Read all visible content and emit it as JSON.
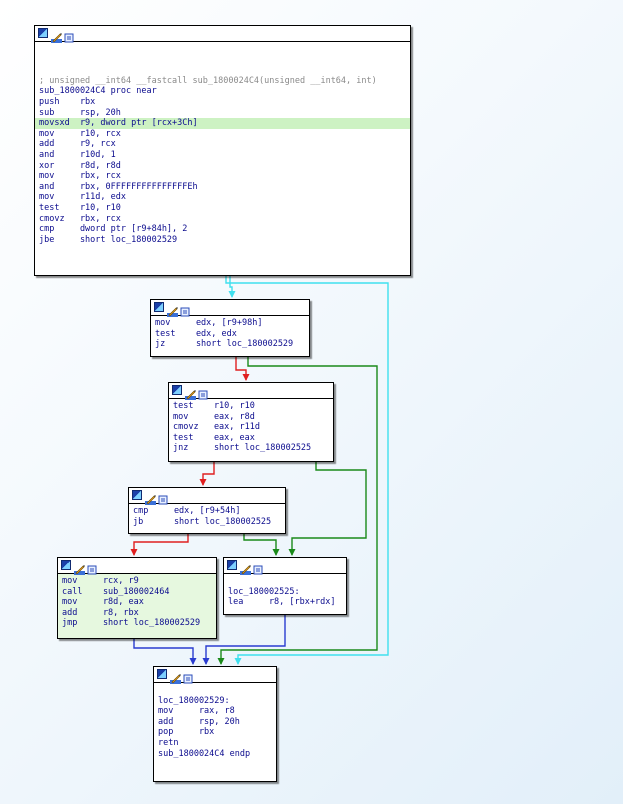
{
  "colors": {
    "edge_true": "#1a8a1a",
    "edge_false": "#e02020",
    "edge_uncond": "#2a3cd0",
    "edge_back": "#3fe0ee",
    "highlight": "#cdf2c3",
    "node_green": "#e6f8df",
    "text_blue": "#0c0c8e",
    "comment_gray": "#8a8a8a"
  },
  "header_icons": [
    "graph-icon",
    "pencil-icon",
    "xref-icon"
  ],
  "nodes": [
    {
      "id": "b0",
      "lines": [
        {
          "text": ""
        },
        {
          "text": ""
        },
        {
          "text": ""
        },
        {
          "text": "; unsigned __int64 __fastcall sub_1800024C4(unsigned __int64, int)",
          "kind": "comment"
        },
        {
          "text": "sub_1800024C4 proc near"
        },
        {
          "text": "push    rbx"
        },
        {
          "text": "sub     rsp, 20h"
        },
        {
          "text": "movsxd  r9, dword ptr [rcx+3Ch]",
          "hl": true
        },
        {
          "text": "mov     r10, rcx"
        },
        {
          "text": "add     r9, rcx"
        },
        {
          "text": "and     r10d, 1"
        },
        {
          "text": "xor     r8d, r8d"
        },
        {
          "text": "mov     rbx, rcx"
        },
        {
          "text": "and     rbx, 0FFFFFFFFFFFFFFFEh"
        },
        {
          "text": "mov     r11d, edx"
        },
        {
          "text": "test    r10, r10"
        },
        {
          "text": "cmovz   rbx, rcx"
        },
        {
          "text": "cmp     dword ptr [r9+84h], 2"
        },
        {
          "text": "jbe     short loc_180002529"
        }
      ]
    },
    {
      "id": "b1",
      "lines": [
        {
          "text": "mov     edx, [r9+98h]"
        },
        {
          "text": "test    edx, edx"
        },
        {
          "text": "jz      short loc_180002529"
        }
      ]
    },
    {
      "id": "b2",
      "lines": [
        {
          "text": "test    r10, r10"
        },
        {
          "text": "mov     eax, r8d"
        },
        {
          "text": "cmovz   eax, r11d"
        },
        {
          "text": "test    eax, eax"
        },
        {
          "text": "jnz     short loc_180002525"
        }
      ]
    },
    {
      "id": "b3",
      "lines": [
        {
          "text": "cmp     edx, [r9+54h]"
        },
        {
          "text": "jb      short loc_180002525"
        }
      ]
    },
    {
      "id": "b4",
      "lines": [
        {
          "text": "mov     rcx, r9"
        },
        {
          "text": "call    sub_180002464"
        },
        {
          "text": "mov     r8d, eax"
        },
        {
          "text": "add     r8, rbx"
        },
        {
          "text": "jmp     short loc_180002529"
        }
      ]
    },
    {
      "id": "b5",
      "lines": [
        {
          "text": ""
        },
        {
          "text": "loc_180002525:"
        },
        {
          "text": "lea     r8, [rbx+rdx]"
        }
      ]
    },
    {
      "id": "b6",
      "lines": [
        {
          "text": ""
        },
        {
          "text": "loc_180002529:"
        },
        {
          "text": "mov     rax, r8"
        },
        {
          "text": "add     rsp, 20h"
        },
        {
          "text": "pop     rbx"
        },
        {
          "text": "retn"
        },
        {
          "text": "sub_1800024C4 endp"
        }
      ]
    }
  ],
  "edges": [
    {
      "from": "b0",
      "to": "b1",
      "kind": "back"
    },
    {
      "from": "b0",
      "to": "b6",
      "kind": "back"
    },
    {
      "from": "b1",
      "to": "b2",
      "kind": "false"
    },
    {
      "from": "b1",
      "to": "b6",
      "kind": "true"
    },
    {
      "from": "b2",
      "to": "b3",
      "kind": "false"
    },
    {
      "from": "b2",
      "to": "b5",
      "kind": "true"
    },
    {
      "from": "b3",
      "to": "b4",
      "kind": "false"
    },
    {
      "from": "b3",
      "to": "b5",
      "kind": "true"
    },
    {
      "from": "b4",
      "to": "b6",
      "kind": "uncond"
    },
    {
      "from": "b5",
      "to": "b6",
      "kind": "uncond"
    }
  ]
}
